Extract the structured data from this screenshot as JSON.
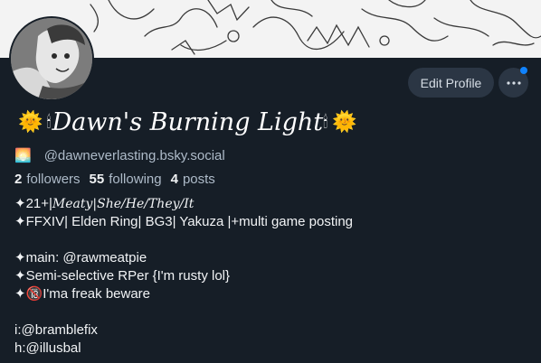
{
  "profile": {
    "display_name": "Dawn's Burning Light",
    "name_prefix_emoji": "🌞",
    "name_candle": "🕯",
    "name_suffix_emoji": "🌞",
    "handle_emoji": "🌅",
    "handle": "@dawneverlasting.bsky.social",
    "edit_button_label": "Edit Profile",
    "more_icon": "ellipsis-icon",
    "accent_color": "#1083fe"
  },
  "stats": {
    "followers_count": "2",
    "followers_label": "followers",
    "following_count": "55",
    "following_label": "following",
    "posts_count": "4",
    "posts_label": "posts"
  },
  "bio": {
    "line1_prefix": "✦21+|",
    "line1_styled": "Meaty|She/He/They/It",
    "line2": "✦FFXIV| Elden Ring| BG3| Yakuza |+multi game posting",
    "line3": "✦main: @rawmeatpie",
    "line4": "✦Semi-selective RPer {I'm rusty lol}",
    "line5_prefix": "✦",
    "line5_emoji": "🔞",
    "line5_text": "I'ma freak beware",
    "line6": "i:@bramblefix",
    "line7": "h:@illusbal"
  }
}
